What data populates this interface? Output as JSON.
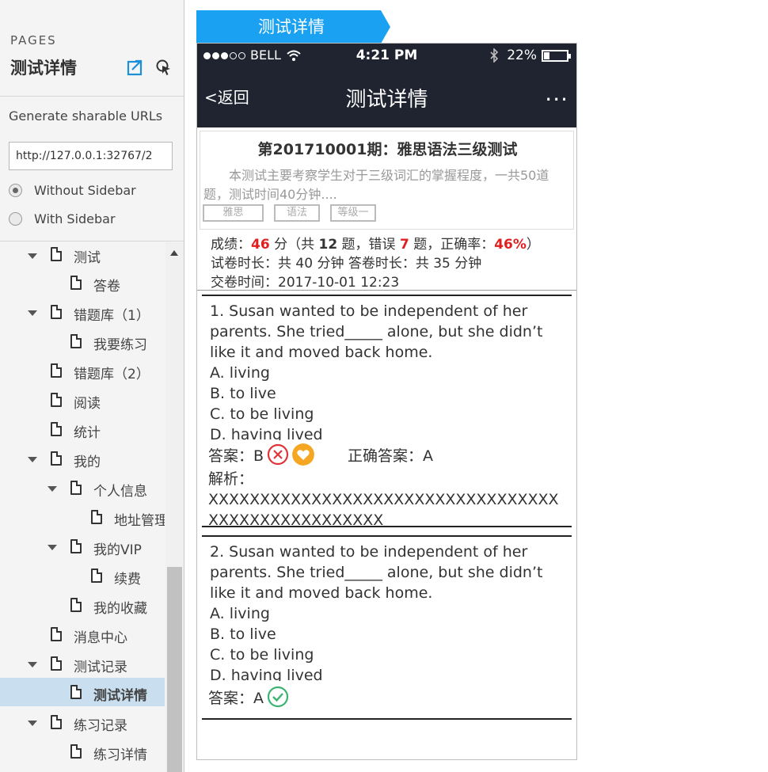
{
  "sidebar": {
    "pages_label": "PAGES",
    "title": "测试详情",
    "share_title": "Generate sharable URLs",
    "url_value": "http://127.0.0.1:32767/2",
    "radio_without": "Without Sidebar",
    "radio_with": "With Sidebar",
    "tree": [
      {
        "label": "测试"
      },
      {
        "label": "答卷"
      },
      {
        "label": "错题库（1）"
      },
      {
        "label": "我要练习"
      },
      {
        "label": "错题库（2）"
      },
      {
        "label": "阅读"
      },
      {
        "label": "统计"
      },
      {
        "label": "我的"
      },
      {
        "label": "个人信息"
      },
      {
        "label": "地址管理"
      },
      {
        "label": "我的VIP"
      },
      {
        "label": "续费"
      },
      {
        "label": "我的收藏"
      },
      {
        "label": "消息中心"
      },
      {
        "label": "测试记录"
      },
      {
        "label": "测试详情"
      },
      {
        "label": "练习记录"
      },
      {
        "label": "练习详情"
      }
    ]
  },
  "main": {
    "tab_label": "测试详情"
  },
  "phone": {
    "status": {
      "carrier": "BELL",
      "time": "4:21 PM",
      "battery": "22%"
    },
    "nav": {
      "back": "返回",
      "title": "测试详情",
      "more": "..."
    },
    "info": {
      "title": "第201710001期：雅思语法三级测试",
      "description": "本测试主要考察学生对于三级词汇的掌握程度，一共50道题，测试时间40分钟....",
      "tags": [
        "雅思",
        "语法",
        "等级一"
      ]
    },
    "result": {
      "score_prefix": "成绩：",
      "score": "46",
      "score_unit": " 分（共 ",
      "total": "12",
      "total_unit": " 题，错误 ",
      "wrong": "7",
      "wrong_unit": " 题，正确率：",
      "rate": "46%",
      "rate_suffix": "）",
      "duration": "试卷时长：共 40 分钟  答卷时长：共 35 分钟",
      "submit_time": "交卷时间：2017-10-01 12:23"
    },
    "questions": [
      {
        "text": "1. Susan wanted to be independent of her parents. She tried_____ alone, but she didn’t like it and moved back home.",
        "options": [
          "A. living",
          "B. to live",
          "C. to be living",
          "D. having lived"
        ],
        "answer_label": "答案：B",
        "correct_label": "正确答案：A",
        "analysis_label": "解析：",
        "analysis": "XXXXXXXXXXXXXXXXXXXXXXXXXXXXXXXXXXXXXXXXXXXXXXXXXXX"
      },
      {
        "text": "2. Susan wanted to be independent of her parents. She tried_____ alone, but she didn’t like it and moved back home.",
        "options": [
          "A. living",
          "B. to live",
          "C. to be living",
          "D. having lived"
        ],
        "answer_label": "答案：A"
      }
    ]
  },
  "colors": {
    "tab_blue": "#1ba1f2",
    "nav_dark": "#1f2430",
    "wrong_red": "#e0343a",
    "fav_orange": "#f5a623",
    "right_green": "#3cb371",
    "active_item": "#c9dff0"
  },
  "icons": [
    "share-icon",
    "pointer-icon",
    "page-icon",
    "caret-icon",
    "wifi-icon",
    "bluetooth-icon",
    "battery-icon",
    "wrong-icon",
    "heart-icon",
    "check-icon"
  ]
}
